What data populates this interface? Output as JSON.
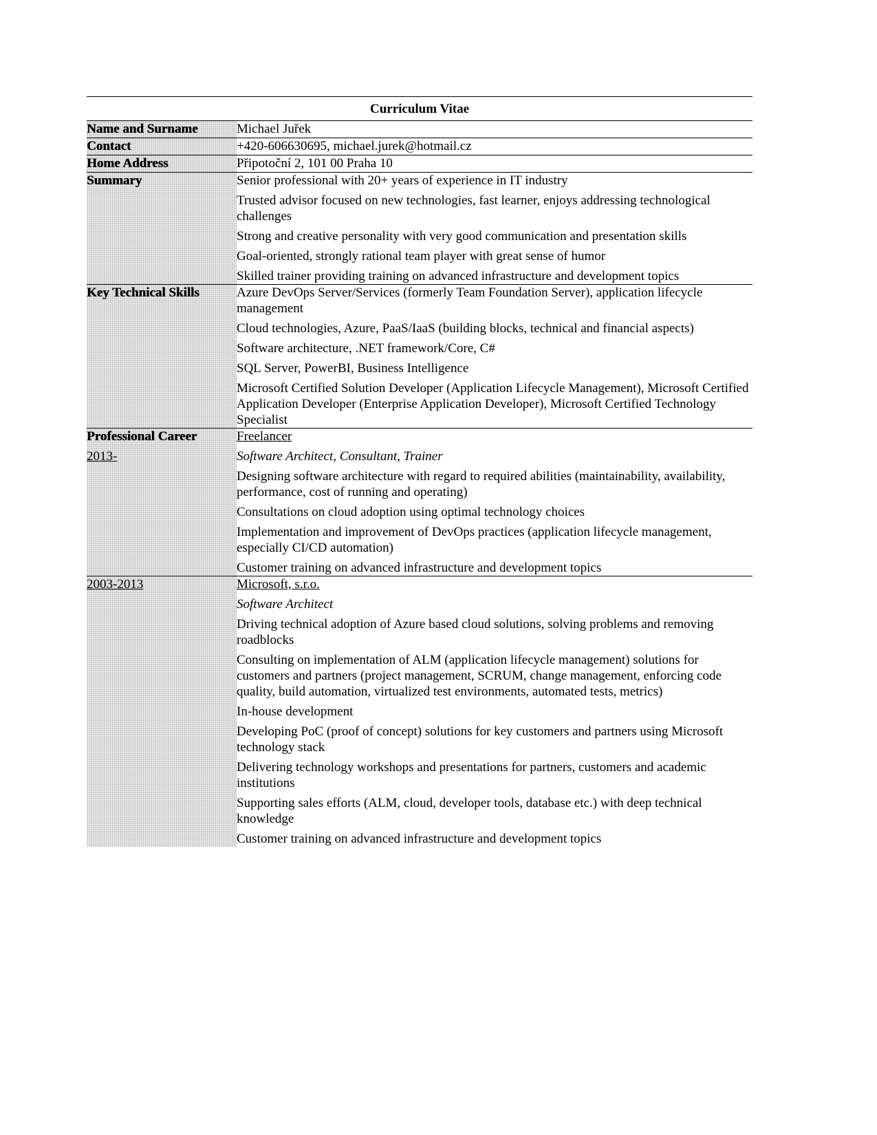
{
  "document": {
    "title": "Curriculum Vitae",
    "personal": [
      {
        "label": "Name and Surname",
        "value": "Michael Juřek"
      },
      {
        "label": "Contact",
        "value": "+420-606630695, michael.jurek@hotmail.cz"
      },
      {
        "label": "Home Address",
        "value": "Připotoční 2, 101 00 Praha 10"
      }
    ],
    "summary": {
      "label": "Summary",
      "items": [
        "Senior professional with 20+ years of experience in IT industry",
        "Trusted advisor focused on new technologies, fast learner, enjoys addressing technological challenges",
        "Strong and creative personality with very good communication and presentation skills",
        "Goal-oriented, strongly rational team player with great sense of humor",
        "Skilled trainer providing training on advanced infrastructure and development topics"
      ]
    },
    "skills": {
      "label": "Key Technical Skills",
      "items": [
        "Azure DevOps Server/Services (formerly Team Foundation Server), application lifecycle management",
        "Cloud technologies, Azure, PaaS/IaaS (building blocks, technical and financial aspects)",
        "Software architecture, .NET framework/Core, C#",
        "SQL Server, PowerBI, Business Intelligence",
        "Microsoft Certified Solution Developer (Application Lifecycle Management), Microsoft Certified Application Developer (Enterprise Application Developer), Microsoft Certified Technology Specialist"
      ]
    },
    "career": {
      "label": "Professional Career",
      "jobs": [
        {
          "period": "2013-",
          "employer": "Freelancer",
          "role": "Software Architect, Consultant, Trainer",
          "items": [
            "Designing software architecture with regard to required abilities (maintainability, availability, performance, cost of running and operating)",
            "Consultations on cloud adoption using optimal technology choices",
            "Implementation and improvement of DevOps practices (application lifecycle management, especially CI/CD automation)",
            "Customer training on advanced infrastructure and development topics"
          ]
        },
        {
          "period": "2003-2013",
          "employer": "Microsoft, s.r.o.",
          "role": "Software Architect",
          "items": [
            "Driving technical adoption of Azure based cloud solutions, solving problems and removing roadblocks",
            "Consulting on implementation of ALM (application lifecycle management) solutions for customers and partners (project management, SCRUM, change management, enforcing code quality, build automation, virtualized test environments, automated tests, metrics)",
            "In-house development",
            "Developing PoC (proof of concept) solutions for key customers and partners using Microsoft technology stack",
            "Delivering technology workshops and presentations for partners, customers and academic institutions",
            "Supporting sales efforts (ALM, cloud, developer tools, database etc.) with deep technical knowledge",
            "Customer training on advanced infrastructure and development topics"
          ]
        }
      ]
    }
  }
}
